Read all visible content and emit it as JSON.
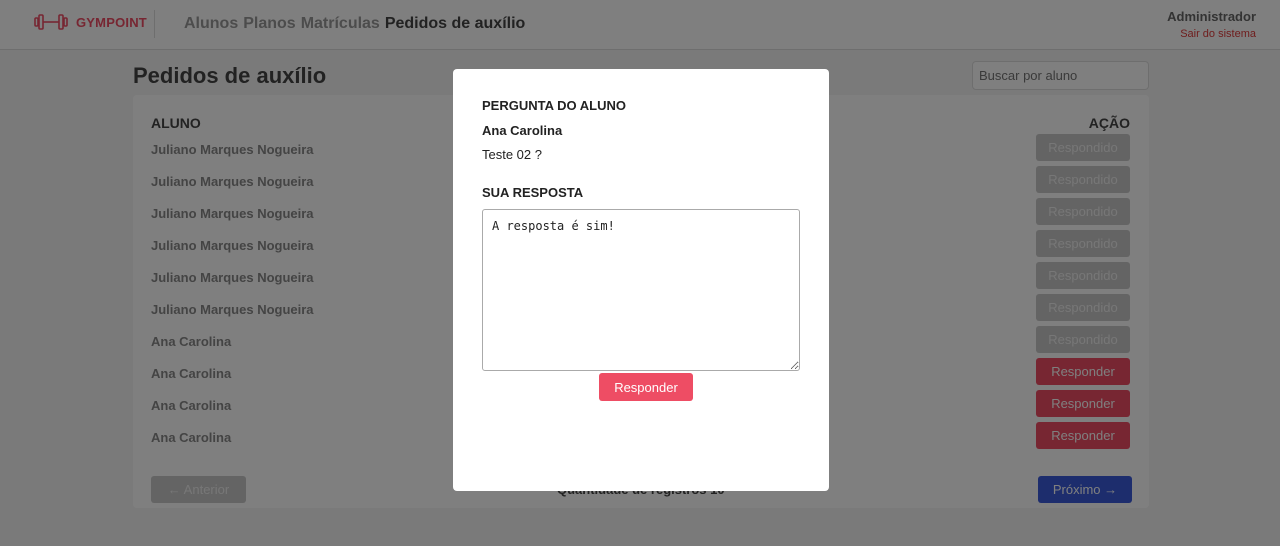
{
  "header": {
    "logo_text": "GYMPOINT",
    "nav": [
      {
        "label": "Alunos",
        "active": false
      },
      {
        "label": "Planos",
        "active": false
      },
      {
        "label": "Matrículas",
        "active": false
      },
      {
        "label": "Pedidos de auxílio",
        "active": true
      }
    ],
    "user_name": "Administrador",
    "logout_label": "Sair do sistema"
  },
  "page": {
    "title": "Pedidos de auxílio",
    "search_placeholder": "Buscar por aluno"
  },
  "table": {
    "col_student": "ALUNO",
    "col_action": "AÇÃO",
    "rows": [
      {
        "name": "Juliano Marques Nogueira",
        "action": "Respondido",
        "answered": true
      },
      {
        "name": "Juliano Marques Nogueira",
        "action": "Respondido",
        "answered": true
      },
      {
        "name": "Juliano Marques Nogueira",
        "action": "Respondido",
        "answered": true
      },
      {
        "name": "Juliano Marques Nogueira",
        "action": "Respondido",
        "answered": true
      },
      {
        "name": "Juliano Marques Nogueira",
        "action": "Respondido",
        "answered": true
      },
      {
        "name": "Juliano Marques Nogueira",
        "action": "Respondido",
        "answered": true
      },
      {
        "name": "Ana Carolina",
        "action": "Respondido",
        "answered": true
      },
      {
        "name": "Ana Carolina",
        "action": "Responder",
        "answered": false
      },
      {
        "name": "Ana Carolina",
        "action": "Responder",
        "answered": false
      },
      {
        "name": "Ana Carolina",
        "action": "Responder",
        "answered": false
      }
    ]
  },
  "pager": {
    "prev_label": "← Anterior",
    "count_text": "Quantidade de registros 10",
    "next_label": "Próximo →"
  },
  "modal": {
    "question_heading": "PERGUNTA DO ALUNO",
    "student_name": "Ana Carolina",
    "question_text": "Teste 02 ?",
    "answer_heading": "SUA RESPOSTA",
    "answer_value": "A resposta é sim!",
    "submit_label": "Responder"
  },
  "colors": {
    "brand": "#ee4d64",
    "primary": "#3b5bdb"
  }
}
